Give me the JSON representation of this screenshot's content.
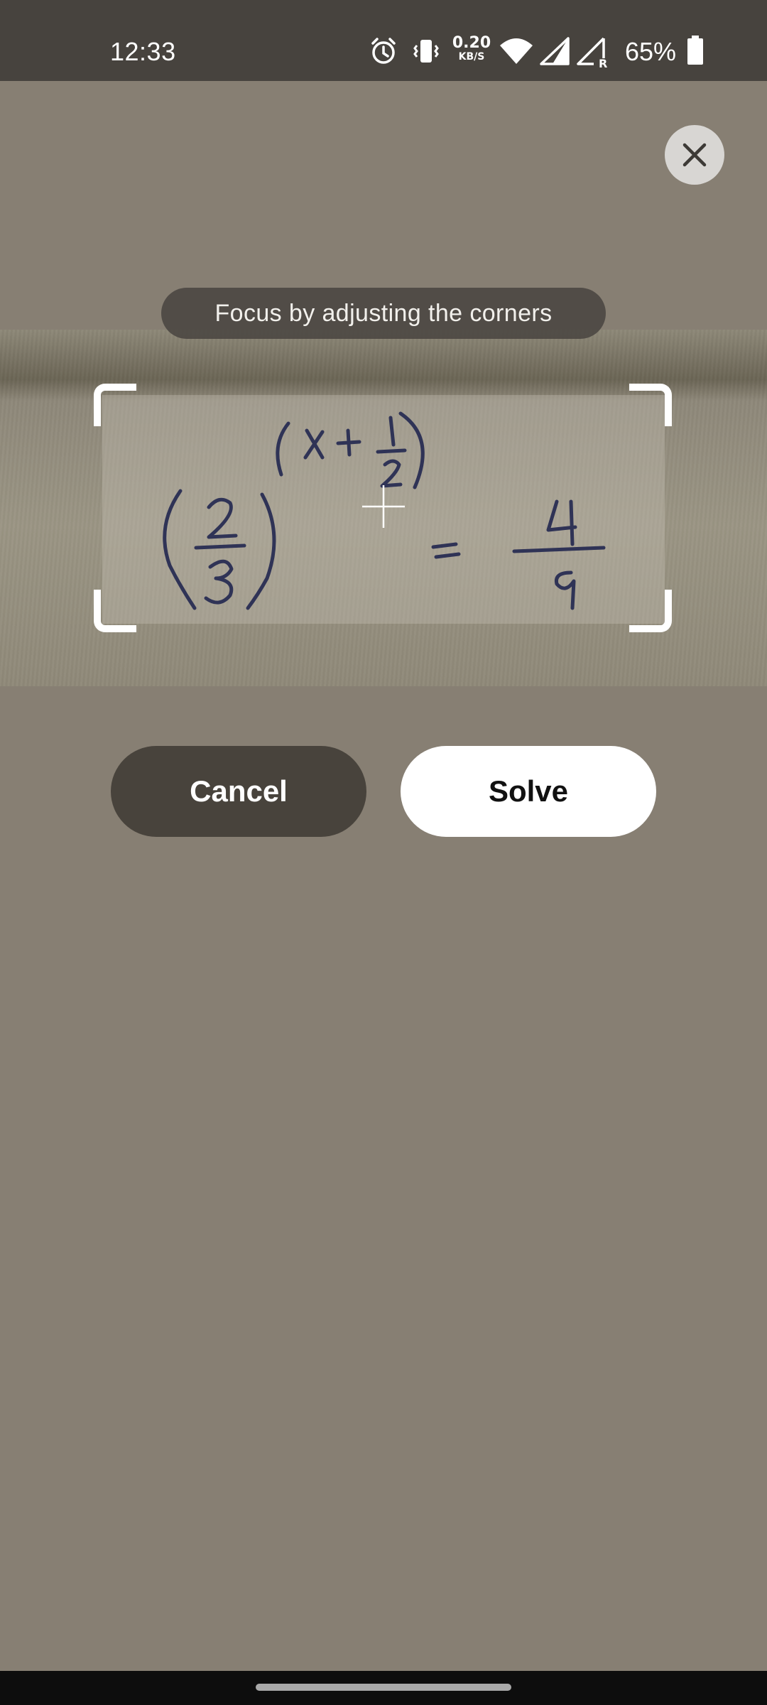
{
  "status_bar": {
    "time": "12:33",
    "net_speed_value": "0.20",
    "net_speed_unit": "KB/S",
    "battery_percent": "65%",
    "icons": [
      "alarm-icon",
      "vibrate-icon",
      "wifi-icon",
      "signal-icon",
      "signal-roaming-icon",
      "battery-icon"
    ]
  },
  "scanner": {
    "hint": "Focus by adjusting the corners",
    "captured_equation": "(2/3)^(x + 1/2) = 4/9"
  },
  "actions": {
    "cancel_label": "Cancel",
    "solve_label": "Solve",
    "close_icon": "close-icon"
  },
  "colors": {
    "background": "#877f73",
    "status_bar": "#47433e",
    "cancel_button": "#48433c",
    "solve_button": "#ffffff"
  }
}
